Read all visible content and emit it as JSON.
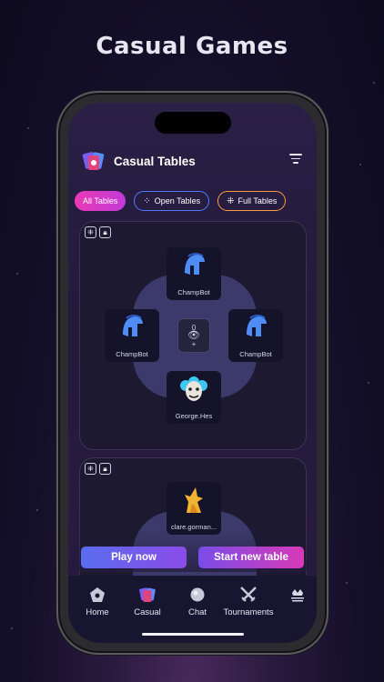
{
  "headline": "Casual Games",
  "app": {
    "title": "Casual Tables"
  },
  "filters": [
    {
      "label": "All Tables",
      "active": true
    },
    {
      "label": "Open Tables",
      "active": false
    },
    {
      "label": "Full Tables",
      "active": false
    }
  ],
  "tables": [
    {
      "seats": {
        "top": "ChampBot",
        "left": "ChampBot",
        "right": "ChampBot",
        "bottom": "George.Hes"
      },
      "center": {
        "top": "0",
        "bottom": "+"
      }
    },
    {
      "seats": {
        "top": "clare.gorman..."
      }
    }
  ],
  "actions": {
    "play_now": "Play now",
    "start_new_table": "Start new table"
  },
  "tabs": [
    {
      "label": "Home",
      "icon": "home-icon"
    },
    {
      "label": "Casual",
      "icon": "cards-icon"
    },
    {
      "label": "Chat",
      "icon": "chat-icon"
    },
    {
      "label": "Tournaments",
      "icon": "swords-icon"
    },
    {
      "label": "",
      "icon": "bridge-champ-logo"
    }
  ],
  "colors": {
    "accent_pink": "#e83ab4",
    "accent_blue": "#4f7cff",
    "accent_orange": "#ff9a3c",
    "felt": "#3c3a6a"
  }
}
